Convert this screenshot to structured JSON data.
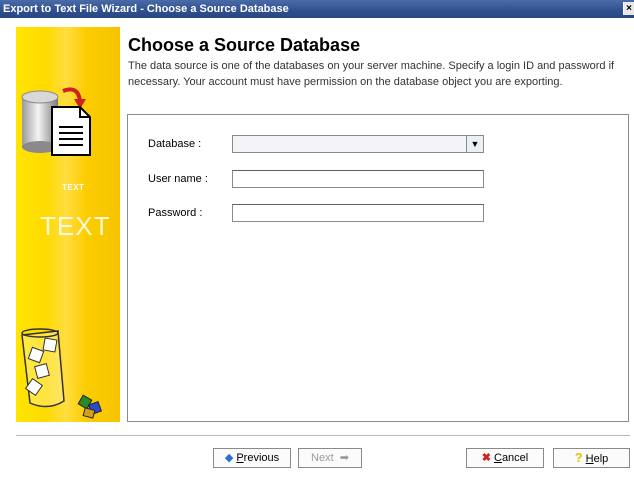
{
  "window": {
    "title": "Export to Text File Wizard - Choose a Source Database",
    "close_glyph": "×"
  },
  "sidebar": {
    "text_small": "TEXT",
    "text_big": "TEXT"
  },
  "header": {
    "title": "Choose a Source Database",
    "description": "The data source is one of the databases on your server machine. Specify a login ID and password if necessary. Your account must have permission on the database object you are exporting."
  },
  "form": {
    "database_label": "Database :",
    "database_value": "",
    "username_label": "User name :",
    "username_value": "",
    "password_label": "Password :",
    "password_value": ""
  },
  "buttons": {
    "previous": {
      "accel": "P",
      "rest": "revious",
      "icon": "arrow-left-icon"
    },
    "next": {
      "label": "Next",
      "icon": "arrow-right-icon",
      "disabled": true
    },
    "cancel": {
      "accel": "C",
      "rest": "ancel",
      "icon": "red-x-icon"
    },
    "help": {
      "accel": "H",
      "rest": "elp",
      "icon": "question-icon"
    }
  },
  "colors": {
    "titlebar": "#2f4f8f",
    "sidebar": "#ffd800",
    "cancel_icon": "#d42020",
    "previous_icon": "#2a6fd0",
    "help_icon": "#e8c000"
  }
}
